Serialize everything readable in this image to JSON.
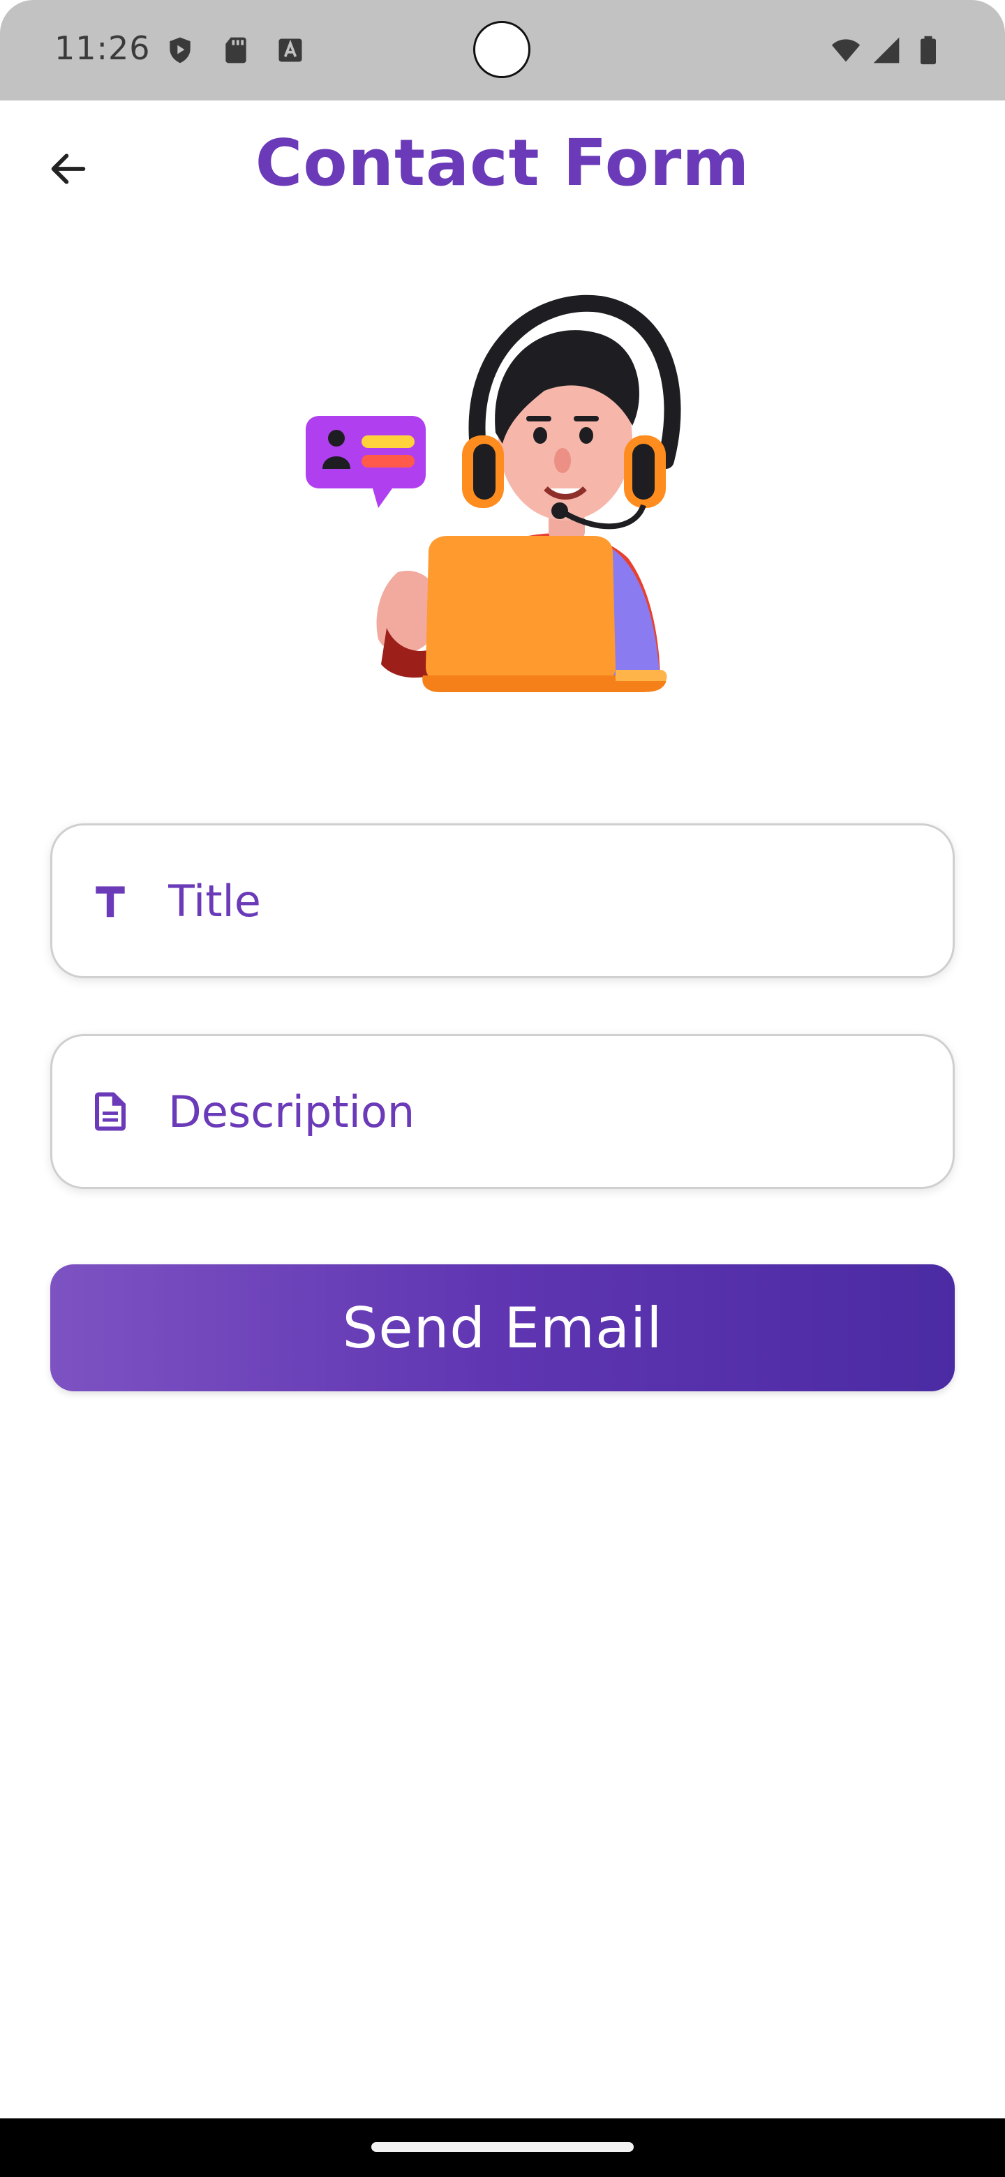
{
  "status_bar": {
    "time": "11:26",
    "left_icons": [
      "shield-play-icon",
      "sd-card-icon",
      "a-box-icon"
    ],
    "right_icons": [
      "wifi-icon",
      "signal-icon",
      "battery-icon"
    ]
  },
  "app_bar": {
    "title": "Contact Form",
    "back_icon": "arrow-left-icon"
  },
  "illustration": {
    "name": "support-agent-illustration"
  },
  "form": {
    "title_field": {
      "placeholder": "Title",
      "value": "",
      "icon": "text-t-icon"
    },
    "description_field": {
      "placeholder": "Description",
      "value": "",
      "icon": "document-icon"
    },
    "send_button_label": "Send Email"
  },
  "colors": {
    "accent": "#6a3ab8",
    "button_gradient_start": "#7d52c2",
    "button_gradient_end": "#4b2ba3",
    "status_bar": "#c2c2c2"
  }
}
